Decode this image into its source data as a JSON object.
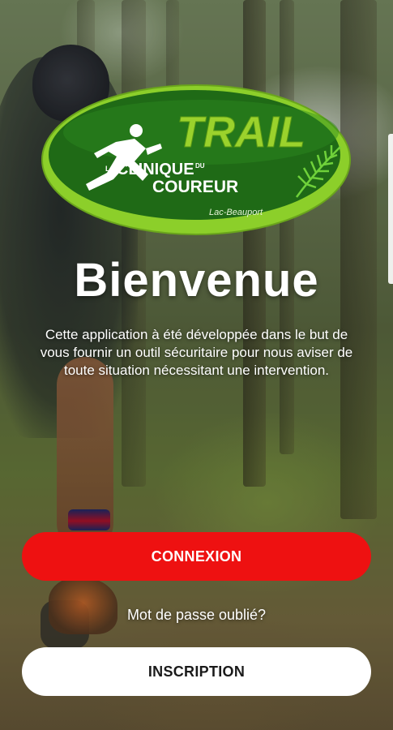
{
  "logo": {
    "main_text": "TRAIL",
    "sub_line1_prefix": "LA",
    "sub_line1": "CLINIQUE",
    "sub_line1_small": "DU",
    "sub_line2": "COUREUR",
    "location": "Lac-Beauport",
    "colors": {
      "outer_green": "#8ccf2a",
      "inner_green": "#1f6a16",
      "text_green": "#9bd22c"
    }
  },
  "welcome": {
    "title": "Bienvenue",
    "description": "Cette application à été développée dans le but de vous fournir un outil sécuritaire pour nous aviser de toute situation nécessitant une intervention."
  },
  "actions": {
    "login_label": "CONNEXION",
    "forgot_password_label": "Mot de passe oublié?",
    "signup_label": "INSCRIPTION"
  },
  "colors": {
    "primary": "#ee1111",
    "secondary_bg": "#ffffff",
    "text_on_dark": "#ffffff"
  },
  "icons": {
    "runner": "runner-icon",
    "fern": "fern-icon"
  }
}
